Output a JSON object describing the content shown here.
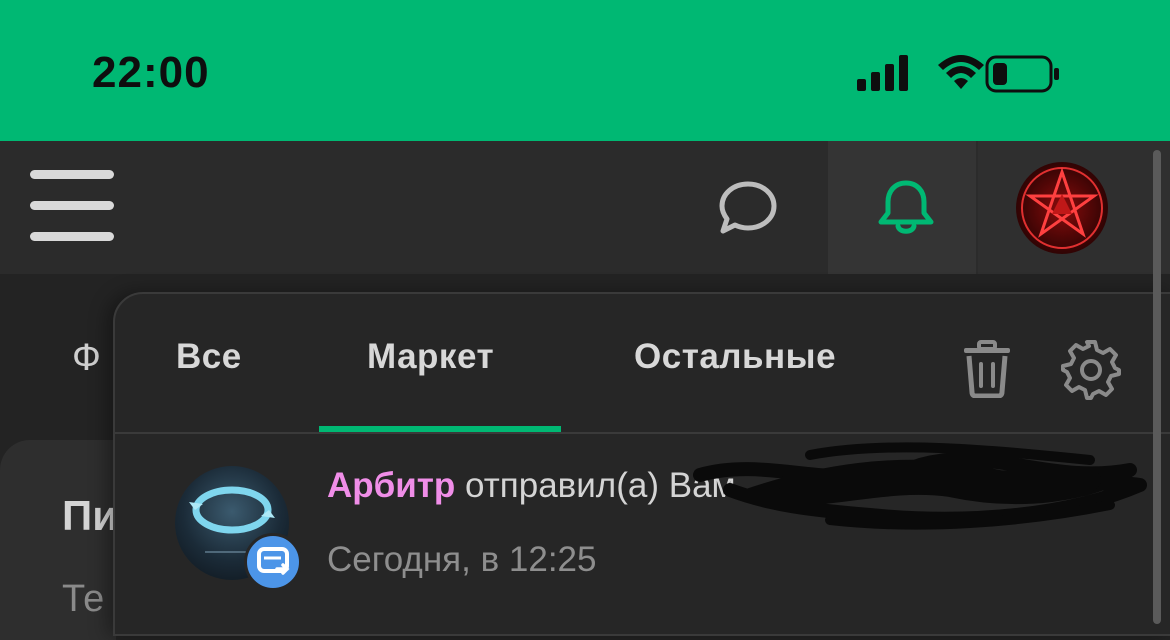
{
  "status_bar": {
    "time": "22:00",
    "icons": [
      "cellular-signal-icon",
      "wifi-icon",
      "battery-low-icon"
    ],
    "battery_color": "#ff3b30"
  },
  "header": {
    "icons": [
      "hamburger-menu-icon",
      "chat-bubble-icon",
      "bell-icon",
      "profile-avatar"
    ],
    "accent_color": "#00b873"
  },
  "background_page": {
    "partial_tab_char": "Ф",
    "card_title_partial": "Пи",
    "card_subtitle_partial": "Те"
  },
  "notifications_panel": {
    "tabs": [
      {
        "label": "Все",
        "active": false
      },
      {
        "label": "Маркет",
        "active": true
      },
      {
        "label": "Остальные",
        "active": false
      }
    ],
    "actions": [
      "trash-icon",
      "gear-icon"
    ],
    "items": [
      {
        "sender": "Арбитр",
        "message": "отправил(а) Вам",
        "time": "Сегодня, в 12:25",
        "badge_icon": "message-forward-icon",
        "sender_color": "#f08ee8"
      }
    ]
  }
}
